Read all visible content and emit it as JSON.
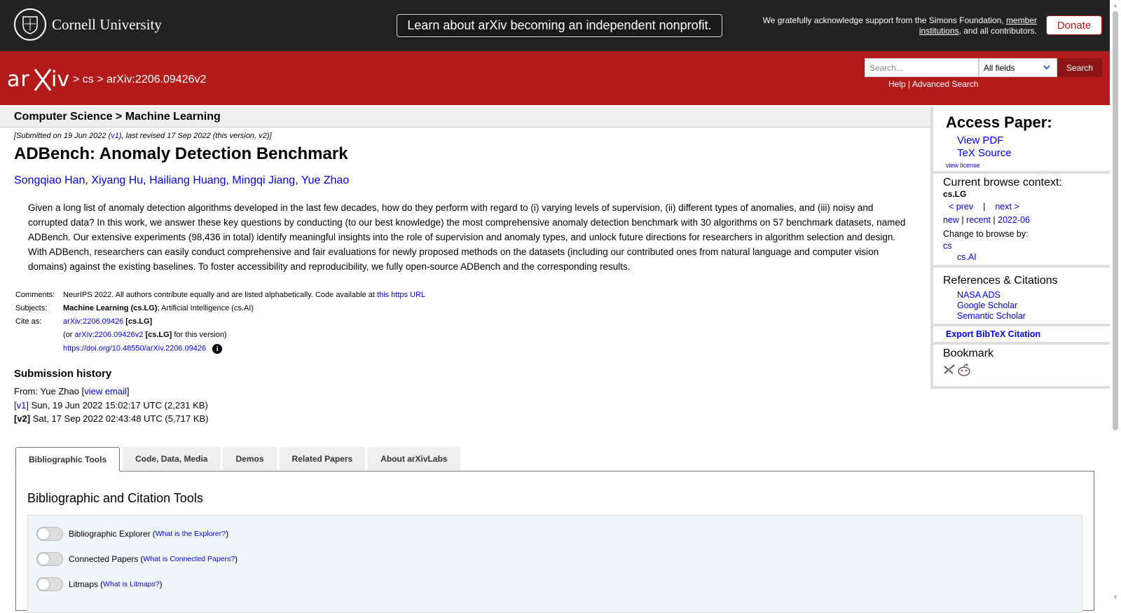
{
  "banner": {
    "university": "Cornell University",
    "nonprofit_button": "Learn about arXiv becoming an independent nonprofit.",
    "support_prefix": "We gratefully acknowledge support from the Simons Foundation,",
    "support_link": "member institutions",
    "support_suffix": ", and all contributors.",
    "donate": "Donate"
  },
  "header": {
    "logo": "arXiv",
    "breadcrumb_sep": ">",
    "breadcrumb_cs": "cs",
    "breadcrumb_id": "arXiv:2206.09426v2",
    "search_placeholder": "Search...",
    "field_selected": "All fields",
    "search_button": "Search",
    "help": "Help",
    "pipe": "|",
    "advanced": "Advanced Search"
  },
  "subheader": "Computer Science > Machine Learning",
  "paper": {
    "dateline_prefix": "[Submitted on 19 Jun 2022 (",
    "dateline_v1": "v1",
    "dateline_suffix": "), last revised 17 Sep 2022 (this version, v2)]",
    "title": "ADBench: Anomaly Detection Benchmark",
    "authors": [
      "Songqiao Han",
      "Xiyang Hu",
      "Hailiang Huang",
      "Mingqi Jiang",
      "Yue Zhao"
    ],
    "author_sep": ",",
    "abstract": "Given a long list of anomaly detection algorithms developed in the last few decades, how do they perform with regard to (i) varying levels of supervision, (ii) different types of anomalies, and (iii) noisy and corrupted data? In this work, we answer these key questions by conducting (to our best knowledge) the most comprehensive anomaly detection benchmark with 30 algorithms on 57 benchmark datasets, named ADBench. Our extensive experiments (98,436 in total) identify meaningful insights into the role of supervision and anomaly types, and unlock future directions for researchers in algorithm selection and design. With ADBench, researchers can easily conduct comprehensive and fair evaluations for newly proposed methods on the datasets (including our contributed ones from natural language and computer vision domains) against the existing baselines. To foster accessibility and reproducibility, we fully open-source ADBench and the corresponding results."
  },
  "meta": {
    "comments_label": "Comments:",
    "comments_text": "NeurIPS 2022. All authors contribute equally and are listed alphabetically. Code available at",
    "comments_link": "this https URL",
    "subjects_label": "Subjects:",
    "subjects_primary": "Machine Learning (cs.LG)",
    "subjects_rest": "; Artificial Intelligence (cs.AI)",
    "cite_label": "Cite as:",
    "cite_id": "arXiv:2206.09426",
    "cite_cat": "[cs.LG]",
    "cite_or": "(or",
    "cite_v2": "arXiv:2206.09426v2",
    "cite_v2_cat": "[cs.LG]",
    "cite_v2_suffix": "for this version)",
    "doi": "https://doi.org/10.48550/arXiv.2206.09426",
    "info_glyph": "i"
  },
  "history": {
    "title": "Submission history",
    "from_prefix": "From: Yue Zhao [",
    "view_email": "view email",
    "from_suffix": "]",
    "v1_label": "[v1]",
    "v1_text": " Sun, 19 Jun 2022 15:02:17 UTC (2,231 KB)",
    "v2_label": "[v2]",
    "v2_text": " Sat, 17 Sep 2022 02:43:48 UTC (5,717 KB)"
  },
  "sidebar": {
    "access_title": "Access Paper:",
    "view_pdf": "View PDF",
    "tex_source": "TeX Source",
    "view_license": "view license",
    "browse_title": "Current browse context:",
    "browse_cat": "cs.LG",
    "prev": "< prev",
    "nav_sep": "|",
    "next": "next >",
    "new": "new",
    "recent": "recent",
    "month": "2022-06",
    "pipe": "|",
    "change_label": "Change to browse by:",
    "change_cs": "cs",
    "change_csai": "cs.AI",
    "refs_title": "References & Citations",
    "nasa": "NASA ADS",
    "google": "Google Scholar",
    "semantic": "Semantic Scholar",
    "export": "Export BibTeX Citation",
    "bookmark_title": "Bookmark"
  },
  "tabs": {
    "items": [
      "Bibliographic Tools",
      "Code, Data, Media",
      "Demos",
      "Related Papers",
      "About arXivLabs"
    ],
    "panel_title": "Bibliographic and Citation Tools",
    "tools": [
      {
        "name": "Bibliographic Explorer",
        "link": "What is the Explorer?"
      },
      {
        "name": "Connected Papers",
        "link": "What is Connected Papers?"
      },
      {
        "name": "Litmaps",
        "link": "What is Litmaps?"
      }
    ],
    "open_paren": "(",
    "close_paren": ")"
  },
  "colors": {
    "arxiv_red": "#b31b1b",
    "banner_dark": "#222222",
    "link_blue": "#0000ee"
  },
  "icons": [
    "cornell-seal-icon",
    "arxiv-logo-icon",
    "chevron-down-icon",
    "info-icon",
    "bibsonomy-icon",
    "reddit-icon"
  ]
}
